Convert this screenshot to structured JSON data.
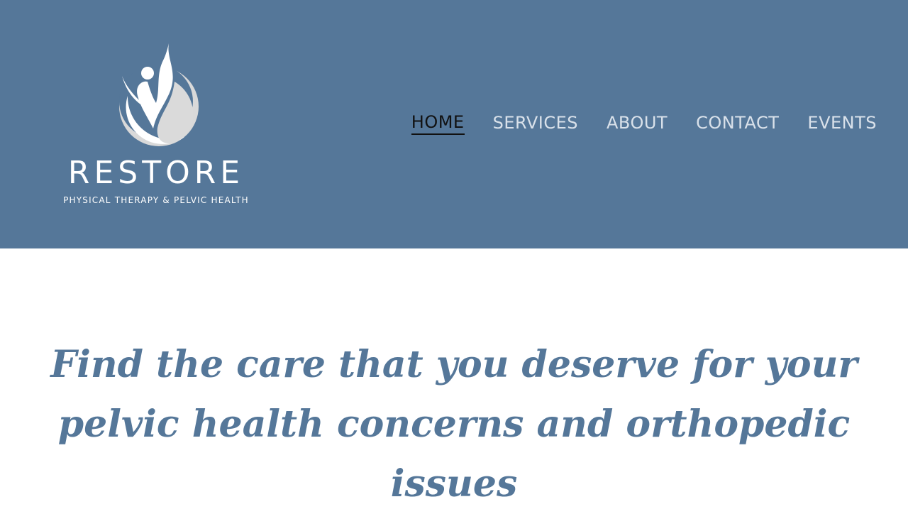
{
  "brand": {
    "name": "RESTORE",
    "tagline": "PHYSICAL THERAPY & PELVIC HEALTH",
    "logo_icon": "figure-leaf-logo-icon"
  },
  "nav": {
    "items": [
      {
        "label": "HOME",
        "active": true
      },
      {
        "label": "SERVICES",
        "active": false
      },
      {
        "label": "ABOUT",
        "active": false
      },
      {
        "label": "CONTACT",
        "active": false
      },
      {
        "label": "EVENTS",
        "active": false
      }
    ]
  },
  "hero": {
    "heading": "Find the care that you deserve for your pelvic health concerns and orthopedic issues"
  },
  "colors": {
    "header_bg": "#557799",
    "accent": "#557799",
    "nav_text": "#d9e1ea",
    "nav_active": "#111111",
    "white": "#ffffff"
  }
}
